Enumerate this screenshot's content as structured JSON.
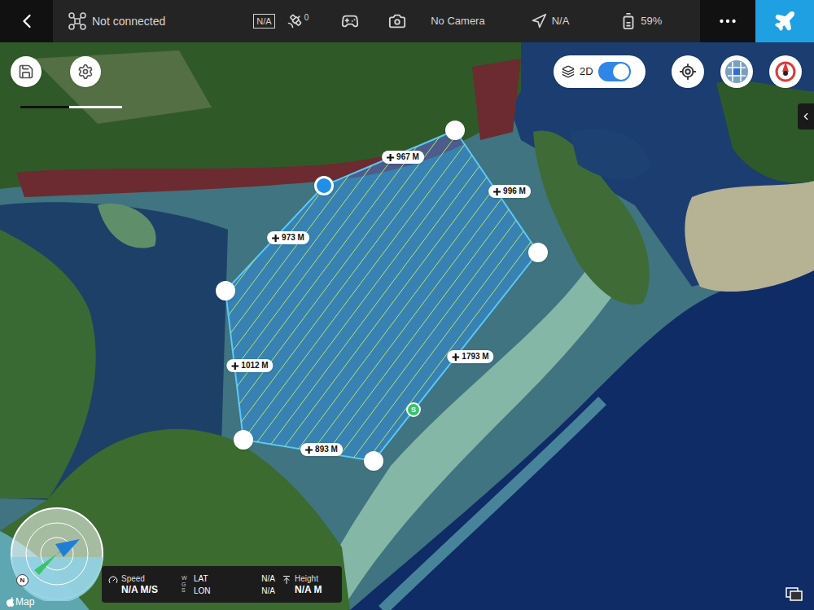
{
  "top_bar": {
    "connection": "Not connected",
    "signal_box": "N/A",
    "satellites": "0",
    "camera": "No Camera",
    "gps": "N/A",
    "battery": "59%"
  },
  "map_controls": {
    "view_mode": "2D",
    "view_toggle_on": true
  },
  "flight_area": {
    "vertices": [
      {
        "selected": false
      },
      {
        "selected": false
      },
      {
        "selected": false
      },
      {
        "selected": false
      },
      {
        "selected": false
      },
      {
        "selected": true
      }
    ],
    "edges": [
      {
        "length": "967 M"
      },
      {
        "length": "996 M"
      },
      {
        "length": "973 M"
      },
      {
        "length": "1012 M"
      },
      {
        "length": "1793 M"
      },
      {
        "length": "893 M"
      }
    ],
    "start_marker": "S"
  },
  "compass": {
    "north": "N"
  },
  "telemetry": {
    "speed_label": "Speed",
    "speed": "N/A M/S",
    "datum": "WGS",
    "lat_label": "LAT",
    "lat": "N/A",
    "lon_label": "LON",
    "lon": "N/A",
    "height_label": "Height",
    "height": "N/A M"
  },
  "attribution": "Map"
}
